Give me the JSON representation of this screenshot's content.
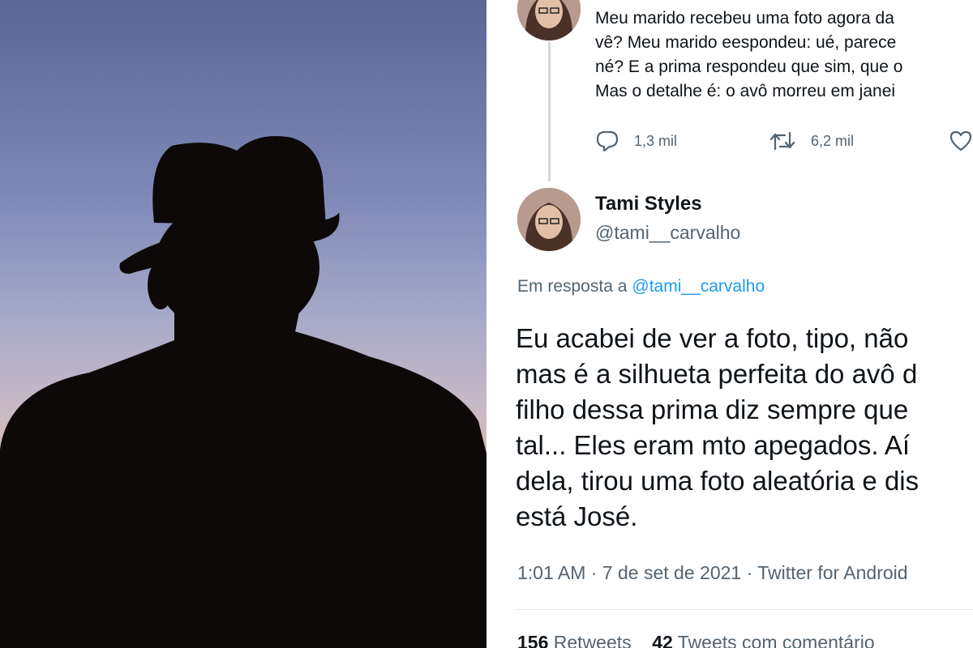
{
  "tweet": {
    "previous": {
      "lines": [
        "Meu marido recebeu uma foto agora da",
        "vê? Meu marido eespondeu: ué, parece",
        "né? E a prima respondeu que sim, que o",
        "Mas o detalhe é: o avô morreu em janei"
      ],
      "replies": "1,3 mil",
      "retweets": "6,2 mil"
    },
    "author": {
      "name": "Tami Styles",
      "handle": "@tami__carvalho"
    },
    "reply_to": {
      "prefix": "Em resposta a",
      "handle": "@tami__carvalho"
    },
    "body_lines": [
      "Eu acabei de ver a foto, tipo, não",
      "mas é a silhueta perfeita do avô d",
      "filho dessa prima diz sempre que",
      "tal... Eles eram mto apegados. Aí",
      "dela, tirou uma foto aleatória e dis",
      "está José."
    ],
    "meta": "1:01 AM · 7 de set de 2021 · Twitter for Android",
    "stats": {
      "retweets_count": "156",
      "retweets_label": "Retweets",
      "quotes_count": "42",
      "quotes_label": "Tweets com comentário"
    }
  },
  "icons": {
    "reply": "reply-icon",
    "retweet": "retweet-icon",
    "like": "heart-icon"
  },
  "colors": {
    "link": "#1d9bf0",
    "secondary_text": "#536471",
    "primary_text": "#0f1419"
  }
}
